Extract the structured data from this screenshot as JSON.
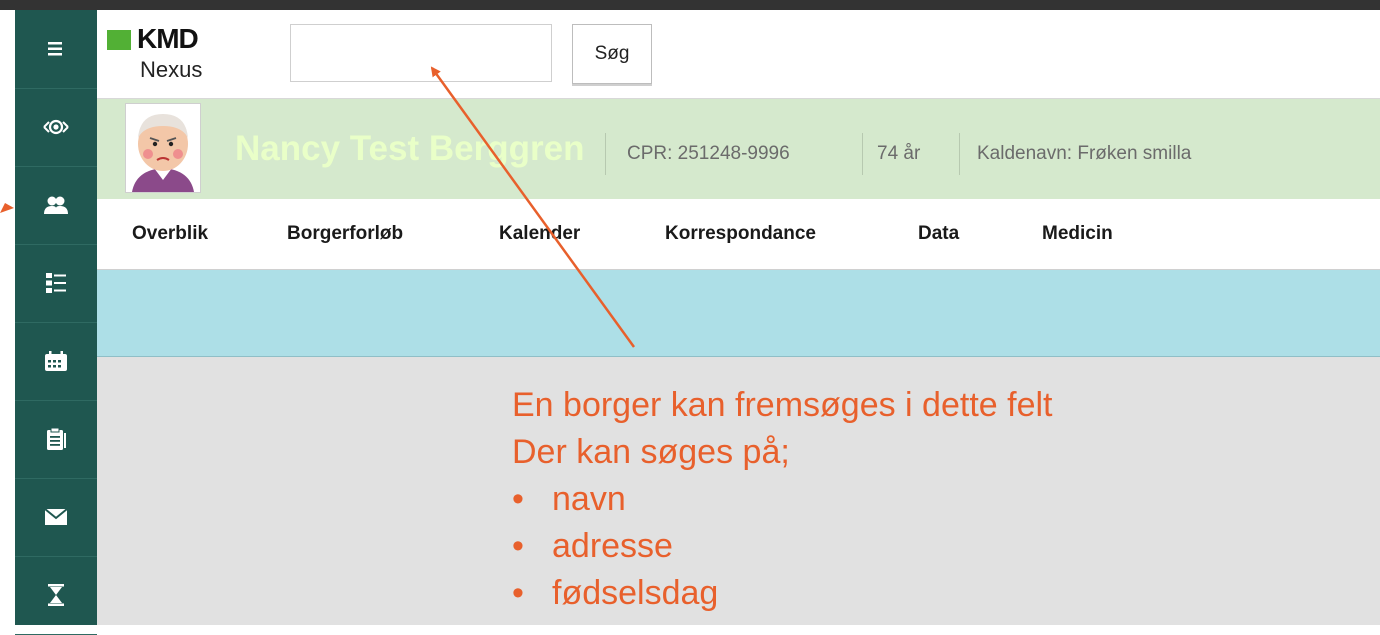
{
  "colors": {
    "sidebar_bg": "#1f5750",
    "citizen_band_bg": "#d5e9cd",
    "citizen_name": "#e9ffc8",
    "blue_strip": "#addfe7",
    "content_bg": "#e1e1e1",
    "annotation": "#e8602c",
    "logo_green": "#52b035"
  },
  "sidebar": {
    "items": [
      {
        "icon": "menu-icon"
      },
      {
        "icon": "eye-icon"
      },
      {
        "icon": "citizens-icon"
      },
      {
        "icon": "checklist-icon"
      },
      {
        "icon": "calendar-icon"
      },
      {
        "icon": "clipboard-icon"
      },
      {
        "icon": "mail-icon"
      },
      {
        "icon": "hourglass-icon"
      }
    ]
  },
  "header": {
    "logo_brand": "KMD",
    "logo_product": "Nexus",
    "search": {
      "value": "",
      "placeholder": ""
    },
    "search_button_label": "Søg"
  },
  "citizen": {
    "name": "Nancy Test Berggren",
    "cpr": "CPR: 251248-9996",
    "age": "74 år",
    "nickname": "Kaldenavn: Frøken smilla"
  },
  "nav": {
    "tabs": [
      {
        "label": "Overblik"
      },
      {
        "label": "Borgerforløb"
      },
      {
        "label": "Kalender"
      },
      {
        "label": "Korrespondance"
      },
      {
        "label": "Data"
      },
      {
        "label": "Medicin"
      }
    ]
  },
  "annotation": {
    "line1": "En borger kan fremsøges i dette felt",
    "line2": "Der kan søges på;",
    "bullet_char": "•",
    "items": [
      "navn",
      "adresse",
      "fødselsdag"
    ]
  }
}
